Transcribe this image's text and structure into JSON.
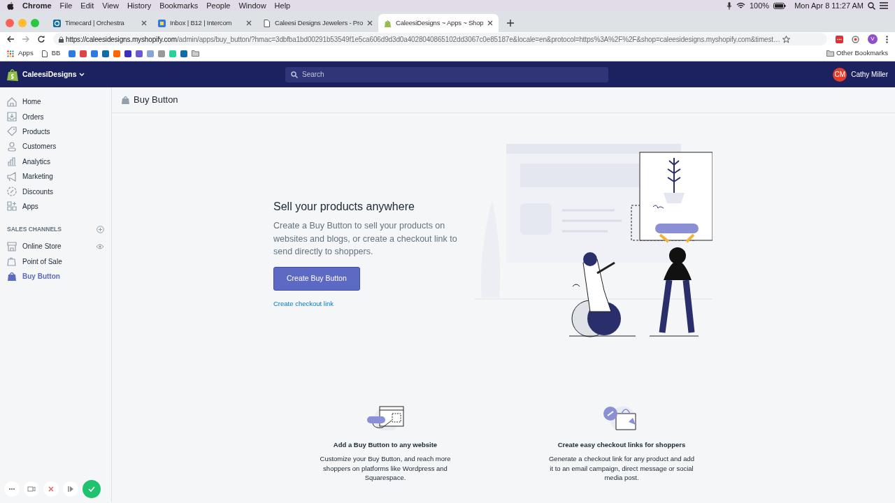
{
  "menubar": {
    "app": "Chrome",
    "menus": [
      "File",
      "Edit",
      "View",
      "History",
      "Bookmarks",
      "People",
      "Window",
      "Help"
    ],
    "battery": "100%",
    "clock": "Mon Apr 8  11:27 AM"
  },
  "browser_tabs": [
    {
      "title": "Timecard | Orchestra",
      "selected": false
    },
    {
      "title": "Inbox | B12 | Intercom",
      "selected": false
    },
    {
      "title": "Caleesi Designs Jewelers - Pro",
      "selected": false
    },
    {
      "title": "CaleesiDesigns ~ Apps ~ Shop",
      "selected": true
    }
  ],
  "address_bar": {
    "url_host": "https://caleesidesigns.myshopify.com",
    "url_rest": "/admin/apps/buy_button/?hmac=3dbfba1bd00291b53549f1e5ca606d9d3d0a4028040865102dd3067c0e85187e&locale=en&protocol=https%3A%2F%2F&shop=caleesidesigns.myshopify.com&timest…",
    "profile": "V"
  },
  "bookmarks": {
    "items": [
      "Apps",
      "BB"
    ],
    "other": "Other Bookmarks"
  },
  "topbar": {
    "store": "CaleesiDesigns",
    "search": {
      "placeholder": "Search"
    },
    "user_initials": "CM",
    "user_name": "Cathy Miller"
  },
  "sidebar": {
    "items": [
      {
        "label": "Home",
        "selected": false
      },
      {
        "label": "Orders",
        "selected": false
      },
      {
        "label": "Products",
        "selected": false
      },
      {
        "label": "Customers",
        "selected": false
      },
      {
        "label": "Analytics",
        "selected": false
      },
      {
        "label": "Marketing",
        "selected": false
      },
      {
        "label": "Discounts",
        "selected": false
      },
      {
        "label": "Apps",
        "selected": false
      }
    ],
    "section_title": "SALES CHANNELS",
    "channels": [
      {
        "label": "Online Store",
        "selected": false
      },
      {
        "label": "Point of Sale",
        "selected": false
      },
      {
        "label": "Buy Button",
        "selected": true
      }
    ]
  },
  "page": {
    "title": "Buy Button",
    "hero_title": "Sell your products anywhere",
    "hero_text": "Create a Buy Button to sell your products on websites and blogs, or create a checkout link to send directly to shoppers.",
    "primary_button": "Create Buy Button",
    "link": "Create checkout link",
    "features": [
      {
        "title": "Add a Buy Button to any website",
        "text": "Customize your Buy Button, and reach more shoppers on platforms like Wordpress and Squarespace."
      },
      {
        "title": "Create easy checkout links for shoppers",
        "text": "Generate a checkout link for any product and add it to an email campaign, direct message or social media post."
      }
    ]
  }
}
